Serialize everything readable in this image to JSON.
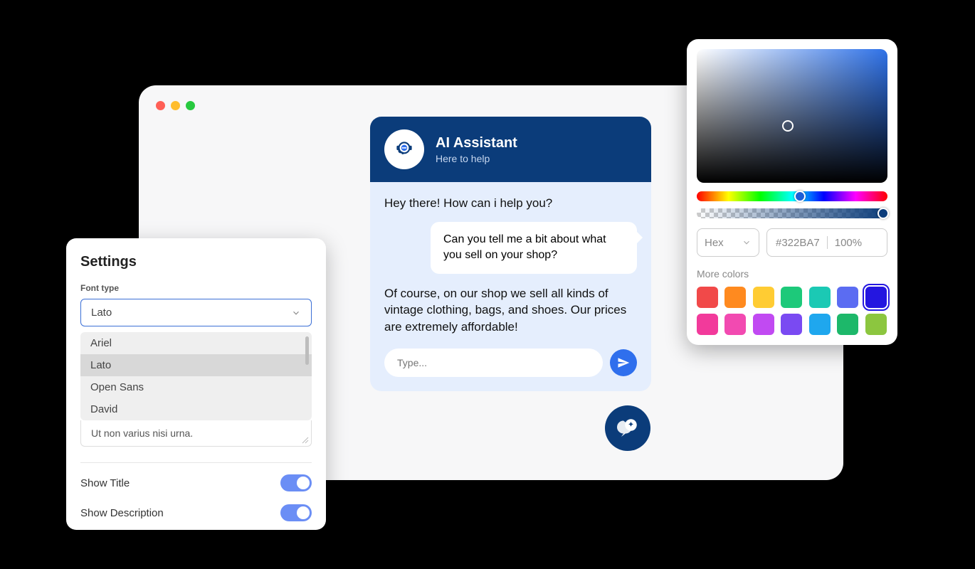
{
  "chat": {
    "title": "AI Assistant",
    "subtitle": "Here to help",
    "messages": {
      "bot1": "Hey there! How can i help you?",
      "user1": "Can you tell me a bit about what you sell on your shop?",
      "bot2": "Of course, on our shop we sell all kinds of vintage clothing, bags, and shoes. Our prices are extremely affordable!"
    },
    "input_placeholder": "Type..."
  },
  "settings": {
    "title": "Settings",
    "font_type_label": "Font type",
    "font_selected": "Lato",
    "font_options": [
      "Ariel",
      "Lato",
      "Open Sans",
      "David"
    ],
    "textarea_text": "Ut non varius nisi urna.",
    "show_title_label": "Show Title",
    "show_title_value": true,
    "show_description_label": "Show Description",
    "show_description_value": true
  },
  "color_picker": {
    "format_label": "Hex",
    "hex_value": "#322BA7",
    "alpha_value": "100%",
    "more_colors_label": "More colors",
    "swatches": [
      "#f14949",
      "#ff8a1f",
      "#ffcc33",
      "#1dc97a",
      "#1bc9b4",
      "#5b6cf2",
      "#2416e0",
      "#f23a9b",
      "#f24ab1",
      "#c14af2",
      "#7a4af2",
      "#1fa7ee",
      "#1db86a",
      "#8cc63f"
    ],
    "selected_swatch_index": 6
  }
}
